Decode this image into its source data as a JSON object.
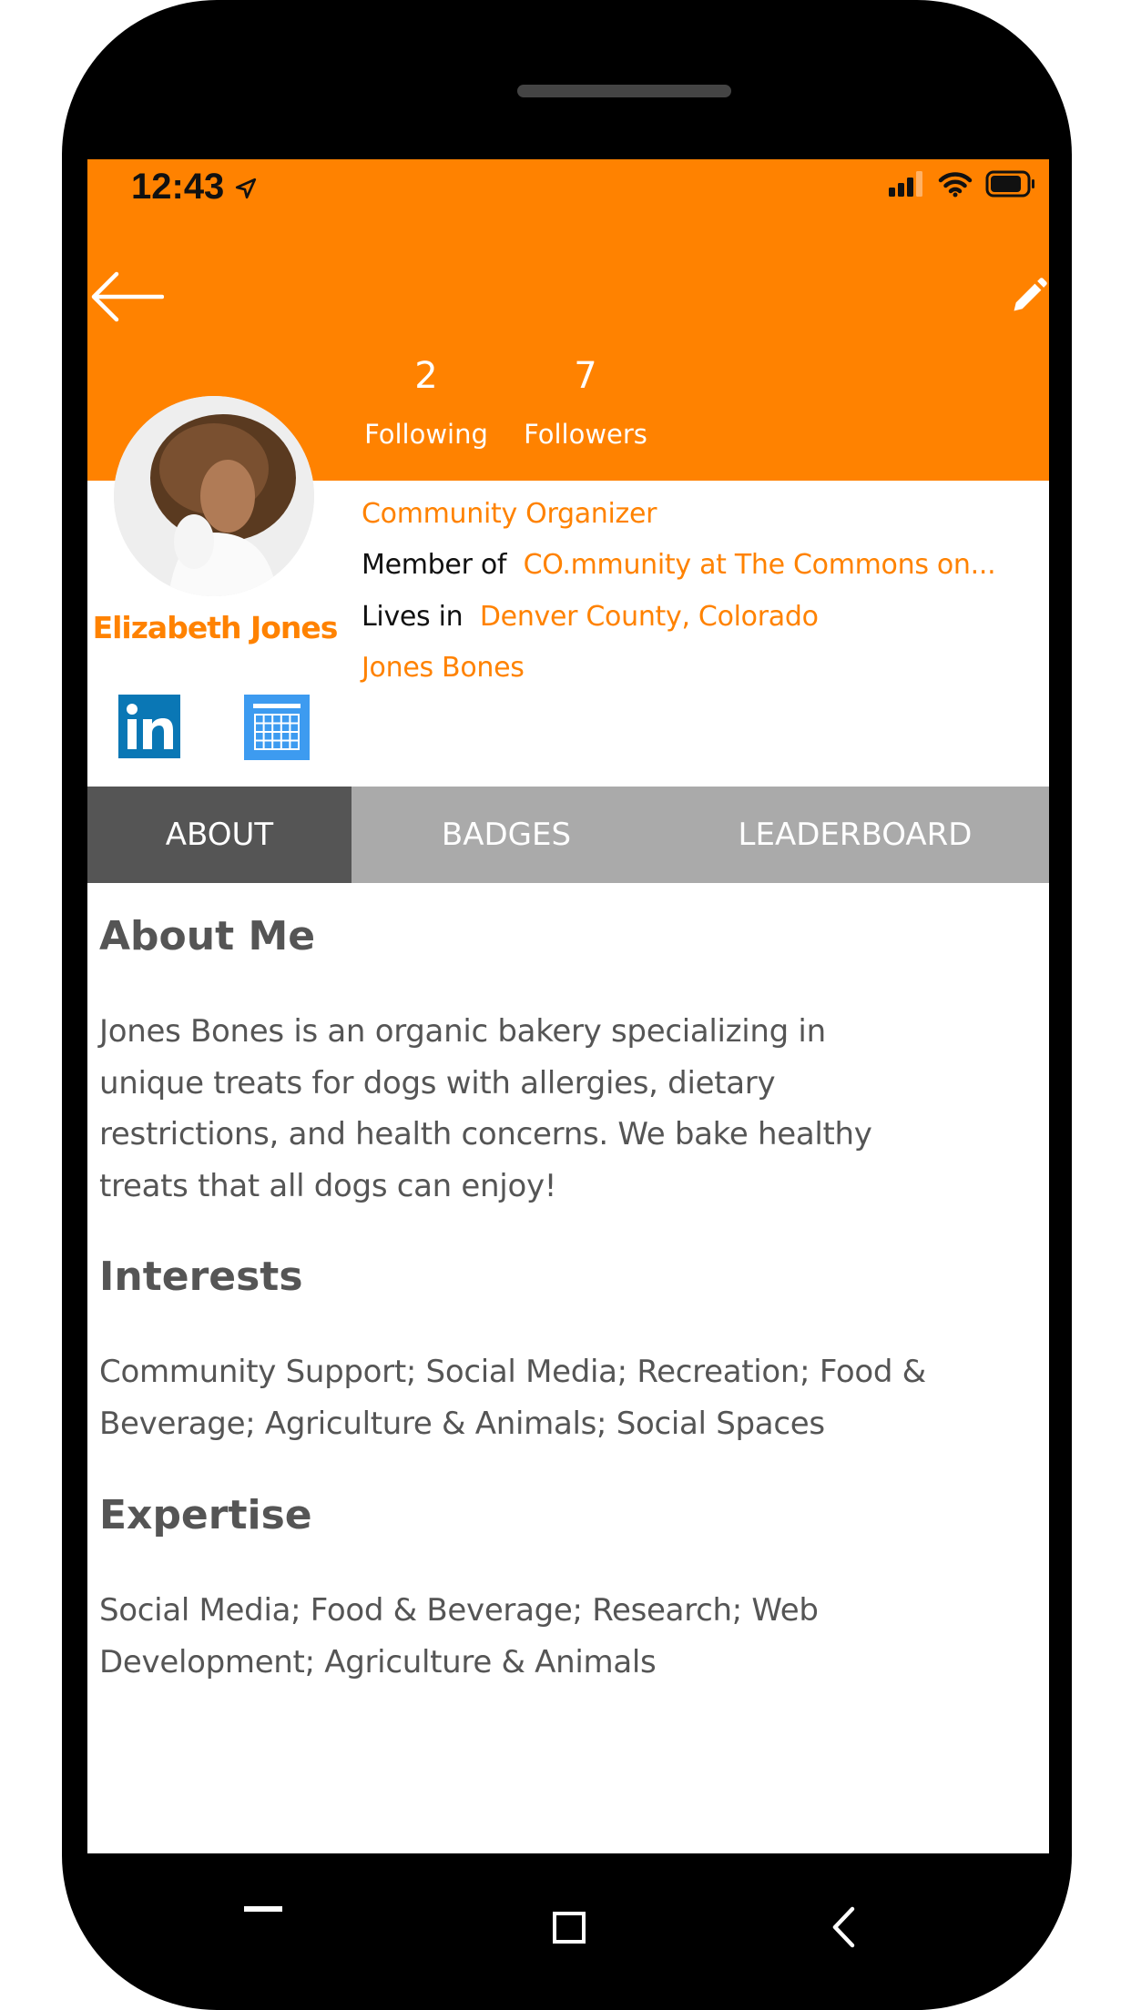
{
  "status_bar": {
    "time": "12:43",
    "location_icon": "location-arrow-icon",
    "signal_icon": "signal-icon",
    "wifi_icon": "wifi-icon",
    "battery_icon": "battery-icon"
  },
  "header": {
    "back_icon": "arrow-left-icon",
    "edit_icon": "pencil-icon",
    "following_count": "2",
    "following_label": "Following",
    "followers_count": "7",
    "followers_label": "Followers"
  },
  "profile": {
    "name": "Elizabeth Jones",
    "role": "Community Organizer",
    "member_prefix": "Member of",
    "member_of": "CO.mmunity at The Commons on...",
    "lives_prefix": "Lives in",
    "lives_in": "Denver County, Colorado",
    "company": "Jones Bones",
    "linkedin_icon": "linkedin-icon",
    "calendar_icon": "calendar-icon"
  },
  "tabs": [
    {
      "label": "ABOUT",
      "active": true
    },
    {
      "label": "BADGES",
      "active": false
    },
    {
      "label": "LEADERBOARD",
      "active": false
    }
  ],
  "about": {
    "about_title": "About Me",
    "about_lines": [
      "Jones Bones is an organic bakery specializing in",
      "unique treats for dogs with allergies, dietary",
      "restrictions, and health concerns. We bake healthy",
      "treats that all dogs can enjoy!"
    ],
    "interests_title": "Interests",
    "interests_lines": [
      "Community Support; Social Media; Recreation; Food &",
      "Beverage; Agriculture & Animals; Social Spaces"
    ],
    "expertise_title": "Expertise",
    "expertise_lines": [
      "Social Media; Food & Beverage; Research; Web",
      "Development; Agriculture & Animals"
    ]
  },
  "colors": {
    "accent": "#ff8200",
    "tab_active": "#555555",
    "tab_inactive": "#aaaaaa",
    "linkedin": "#0a77b5",
    "calendar": "#3d9bf0"
  }
}
